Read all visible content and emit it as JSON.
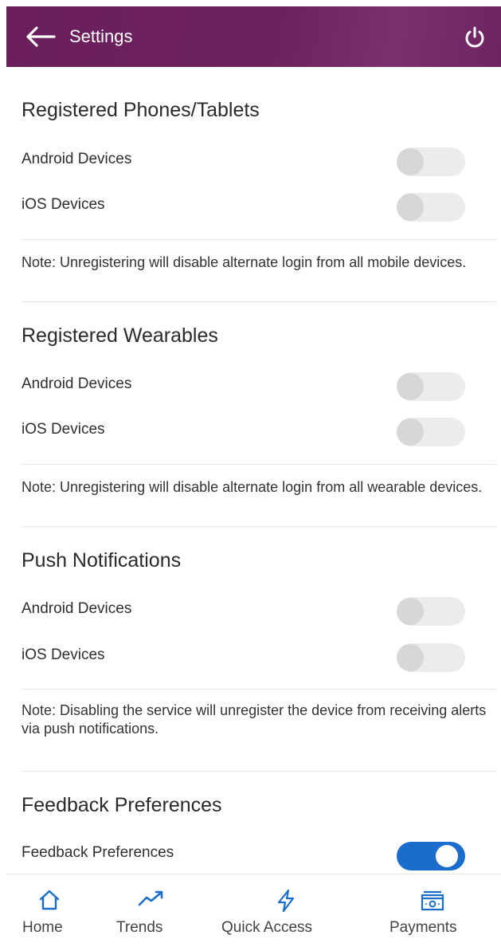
{
  "header": {
    "title": "Settings"
  },
  "sections": [
    {
      "title": "Registered Phones/Tablets",
      "rows": [
        {
          "label": "Android Devices",
          "enabled": false
        },
        {
          "label": "iOS Devices",
          "enabled": false
        }
      ],
      "note": "Note: Unregistering will disable alternate login from all mobile devices."
    },
    {
      "title": "Registered Wearables",
      "rows": [
        {
          "label": "Android Devices",
          "enabled": false
        },
        {
          "label": "iOS Devices",
          "enabled": false
        }
      ],
      "note": "Note: Unregistering will disable alternate login from all wearable devices."
    },
    {
      "title": "Push Notifications",
      "rows": [
        {
          "label": "Android Devices",
          "enabled": false
        },
        {
          "label": "iOS Devices",
          "enabled": false
        }
      ],
      "note": "Note: Disabling the service will unregister the device from receiving alerts via push notifications."
    },
    {
      "title": "Feedback Preferences",
      "rows": [
        {
          "label": "Feedback Preferences",
          "enabled": true
        }
      ]
    }
  ],
  "bottom_nav": [
    {
      "label": "Home",
      "icon": "home-icon"
    },
    {
      "label": "Trends",
      "icon": "trends-icon"
    },
    {
      "label": "Quick Access",
      "icon": "lightning-icon"
    },
    {
      "label": "Payments",
      "icon": "payments-icon"
    }
  ],
  "colors": {
    "header": "#6a1f5c",
    "accent": "#1b6dcc",
    "icon": "#1b6dcc"
  }
}
